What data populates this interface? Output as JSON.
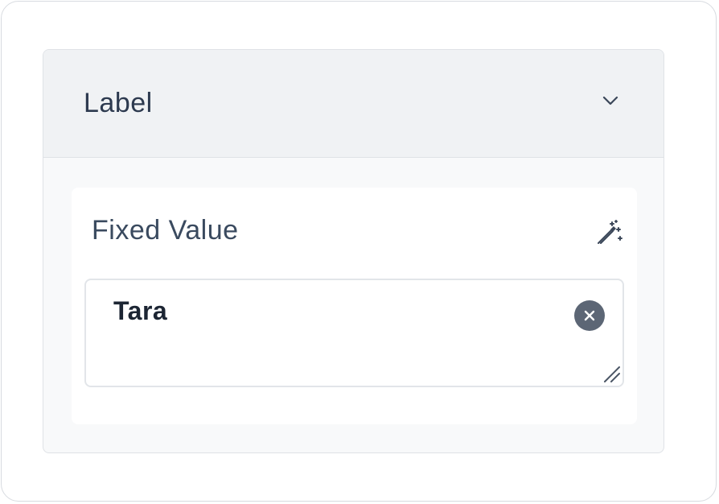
{
  "section": {
    "title": "Label",
    "collapse_icon": "chevron-down-icon"
  },
  "field": {
    "label": "Fixed Value",
    "action_icon": "magic-wand-icon",
    "value": "Tara",
    "clear_icon": "close-circle-icon",
    "resize_icon": "resize-handle-icon"
  },
  "colors": {
    "header_background": "#f0f2f4",
    "panel_background": "#f8f9fa",
    "title_text": "#2d3a4f",
    "value_text": "#1c2533",
    "clear_button": "#5c6675"
  }
}
